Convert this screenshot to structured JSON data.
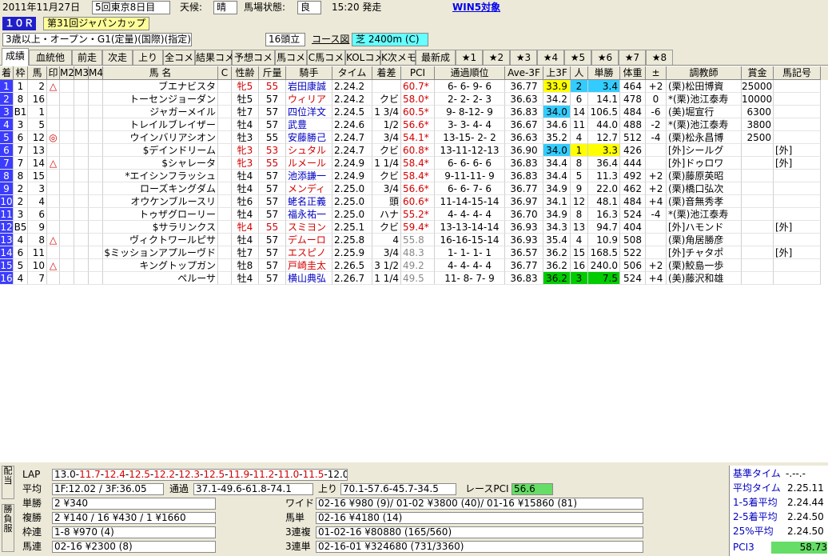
{
  "header": {
    "date": "2011年11月27日",
    "meeting": "5回東京8日目",
    "weather_label": "天候:",
    "weather": "晴",
    "track_label": "馬場状態:",
    "track": "良",
    "post_time": "15:20 発走",
    "win5": "WIN5対象",
    "race_no": "１０Ｒ",
    "race_name": "第31回ジャパンカップ",
    "condition": "3歳以上・オープン・G1(定量)(国際)(指定)",
    "runners": "16頭立",
    "course_btn": "コース図",
    "course": "芝 2400m (C)"
  },
  "tabs": [
    "成績",
    "血統他",
    "前走",
    "次走",
    "上り",
    "全コメ",
    "結果コメ",
    "予想コメ",
    "馬コメ",
    "C馬コメ",
    "KOLコメ",
    "K次メモ",
    "最新成",
    "★1",
    "★2",
    "★3",
    "★4",
    "★5",
    "★6",
    "★7",
    "★8"
  ],
  "columns": [
    "着",
    "枠",
    "馬",
    "印",
    "M2",
    "M3",
    "M4",
    "馬 名",
    "C",
    "性齢",
    "斤量",
    "騎手",
    "タイム",
    "着差",
    "PCI",
    "通過順位",
    "Ave-3F",
    "上3F",
    "人",
    "単勝",
    "体重",
    "±",
    "調教師",
    "賞金",
    "馬記号"
  ],
  "rows": [
    [
      "1",
      "1",
      "2",
      "△",
      "",
      "",
      "",
      "ブエナビスタ",
      "",
      "牝5",
      "55",
      "岩田康誠",
      "2.24.2",
      "",
      "60.7*",
      "6- 6- 9- 6",
      "36.77",
      "33.9",
      "2",
      "3.4",
      "464",
      "+2",
      "(栗)松田博資",
      "25000",
      ""
    ],
    [
      "2",
      "8",
      "16",
      "",
      "",
      "",
      "",
      "トーセンジョーダン",
      "",
      "牡5",
      "57",
      "ウィリア",
      "2.24.2",
      "クビ",
      "58.0*",
      "2- 2- 2- 3",
      "36.63",
      "34.2",
      "6",
      "14.1",
      "478",
      "0",
      "*(栗)池江泰寿",
      "10000",
      ""
    ],
    [
      "3",
      "B1",
      "1",
      "",
      "",
      "",
      "",
      "ジャガーメイル",
      "",
      "牡7",
      "57",
      "四位洋文",
      "2.24.5",
      "1 3/4",
      "60.5*",
      "9- 8-12- 9",
      "36.83",
      "34.0",
      "14",
      "106.5",
      "484",
      "-6",
      "(美)堀宣行",
      "6300",
      ""
    ],
    [
      "4",
      "3",
      "5",
      "",
      "",
      "",
      "",
      "トレイルブレイザー",
      "",
      "牡4",
      "57",
      "武豊",
      "2.24.6",
      "1/2",
      "56.6*",
      "3- 3- 4- 4",
      "36.67",
      "34.6",
      "11",
      "44.0",
      "488",
      "-2",
      "*(栗)池江泰寿",
      "3800",
      ""
    ],
    [
      "5",
      "6",
      "12",
      "◎",
      "",
      "",
      "",
      "ウインバリアシオン",
      "",
      "牡3",
      "55",
      "安藤勝己",
      "2.24.7",
      "3/4",
      "54.1*",
      "13-15- 2- 2",
      "36.63",
      "35.2",
      "4",
      "12.7",
      "512",
      "-4",
      "(栗)松永昌博",
      "2500",
      ""
    ],
    [
      "6",
      "7",
      "13",
      "",
      "",
      "",
      "",
      "$デインドリーム",
      "",
      "牝3",
      "53",
      "シュタル",
      "2.24.7",
      "クビ",
      "60.8*",
      "13-11-12-13",
      "36.90",
      "34.0",
      "1",
      "3.3",
      "426",
      "",
      "[外]シールグ",
      "",
      "[外]"
    ],
    [
      "7",
      "7",
      "14",
      "△",
      "",
      "",
      "",
      "$シャレータ",
      "",
      "牝3",
      "55",
      "ルメール",
      "2.24.9",
      "1 1/4",
      "58.4*",
      "6- 6- 6- 6",
      "36.83",
      "34.4",
      "8",
      "36.4",
      "444",
      "",
      "[外]ドゥロワ",
      "",
      "[外]"
    ],
    [
      "8",
      "8",
      "15",
      "",
      "",
      "",
      "",
      "*エイシンフラッシュ",
      "",
      "牡4",
      "57",
      "池添謙一",
      "2.24.9",
      "クビ",
      "58.4*",
      "9-11-11- 9",
      "36.83",
      "34.4",
      "5",
      "11.3",
      "492",
      "+2",
      "(栗)藤原英昭",
      "",
      ""
    ],
    [
      "9",
      "2",
      "3",
      "",
      "",
      "",
      "",
      "ローズキングダム",
      "",
      "牡4",
      "57",
      "メンディ",
      "2.25.0",
      "3/4",
      "56.6*",
      "6- 6- 7- 6",
      "36.77",
      "34.9",
      "9",
      "22.0",
      "462",
      "+2",
      "(栗)橋口弘次",
      "",
      ""
    ],
    [
      "10",
      "2",
      "4",
      "",
      "",
      "",
      "",
      "オウケンブルースリ",
      "",
      "牡6",
      "57",
      "蛯名正義",
      "2.25.0",
      "頭",
      "60.6*",
      "11-14-15-14",
      "36.97",
      "34.1",
      "12",
      "48.1",
      "484",
      "+4",
      "(栗)音無秀孝",
      "",
      ""
    ],
    [
      "11",
      "3",
      "6",
      "",
      "",
      "",
      "",
      "トゥザグローリー",
      "",
      "牡4",
      "57",
      "福永祐一",
      "2.25.0",
      "ハナ",
      "55.2*",
      "4- 4- 4- 4",
      "36.70",
      "34.9",
      "8",
      "16.3",
      "524",
      "-4",
      "*(栗)池江泰寿",
      "",
      ""
    ],
    [
      "12",
      "B5",
      "9",
      "",
      "",
      "",
      "",
      "$サラリンクス",
      "",
      "牝4",
      "55",
      "スミヨン",
      "2.25.1",
      "クビ",
      "59.4*",
      "13-13-14-14",
      "36.93",
      "34.3",
      "13",
      "94.7",
      "404",
      "",
      "[外]ハモンド",
      "",
      "[外]"
    ],
    [
      "13",
      "4",
      "8",
      "△",
      "",
      "",
      "",
      "ヴィクトワールピサ",
      "",
      "牡4",
      "57",
      "デムーロ",
      "2.25.8",
      "4",
      "55.8",
      "16-16-15-14",
      "36.93",
      "35.4",
      "4",
      "10.9",
      "508",
      "",
      "(栗)角居勝彦",
      "",
      ""
    ],
    [
      "14",
      "6",
      "11",
      "",
      "",
      "",
      "",
      "$ミッションアプルーヴド",
      "",
      "牡7",
      "57",
      "エスピノ",
      "2.25.9",
      "3/4",
      "48.3",
      "1- 1- 1- 1",
      "36.57",
      "36.2",
      "15",
      "168.5",
      "522",
      "",
      "[外]チャタポ",
      "",
      "[外]"
    ],
    [
      "15",
      "5",
      "10",
      "△",
      "",
      "",
      "",
      "キングトップガン",
      "",
      "牡8",
      "57",
      "戸崎圭太",
      "2.26.5",
      "3 1/2",
      "49.2",
      "4- 4- 4- 4",
      "36.77",
      "36.2",
      "16",
      "240.0",
      "506",
      "+2",
      "(栗)鮫島一歩",
      "",
      ""
    ],
    [
      "16",
      "4",
      "7",
      "",
      "",
      "",
      "",
      "ペルーサ",
      "",
      "牡4",
      "57",
      "横山典弘",
      "2.26.7",
      "1 1/4",
      "49.5",
      "11- 8- 7- 9",
      "36.83",
      "36.2",
      "3",
      "7.5",
      "524",
      "+4",
      "(美)藤沢和雄",
      "",
      ""
    ]
  ],
  "bottom": {
    "lap_label": "LAP",
    "lap_values": [
      "13.0",
      "11.7",
      "12.4",
      "12.5",
      "12.2",
      "12.3",
      "12.5",
      "11.9",
      "11.2",
      "11.0",
      "11.5",
      "12.0"
    ],
    "avg_label": "平均",
    "avg": "1F:12.02 / 3F:36.05",
    "pass_label": "通過",
    "pass": "37.1-49.6-61.8-74.1",
    "agari_label": "上り",
    "agari": "70.1-57.6-45.7-34.5",
    "race_pci_label": "レースPCI",
    "race_pci": "56.6",
    "vtab1": "配当",
    "vtab2": "勝負服",
    "tansho_label": "単勝",
    "tansho": "2 ¥340",
    "fukusho_label": "複勝",
    "fukusho": "2 ¥140 / 16 ¥430 / 1 ¥1660",
    "wakuren_label": "枠連",
    "wakuren": "1-8 ¥970 (4)",
    "umaren_label": "馬連",
    "umaren": "02-16 ¥2300 (8)",
    "wide_label": "ワイド",
    "wide": "02-16 ¥980 (9)/ 01-02 ¥3800 (40)/ 01-16 ¥15860 (81)",
    "umatan_label": "馬単",
    "umatan": "02-16 ¥4180 (14)",
    "sanrenpuku_label": "3連複",
    "sanrenpuku": "01-02-16 ¥80880 (165/560)",
    "sanrentan_label": "3連単",
    "sanrentan": "02-16-01 ¥324680 (731/3360)",
    "base_time_label": "基準タイム",
    "base_time": "-.--.-",
    "avg_time_label": "平均タイム",
    "avg_time": "2.25.11",
    "top5_label": "1-5着平均",
    "top5": "2.24.44",
    "top2_5_label": "2-5着平均",
    "top2_5": "2.24.50",
    "pct25_label": "25%平均",
    "pct25": "2.24.50",
    "pci3_label": "PCI3",
    "pci3": "58.73"
  },
  "colors": {
    "waku": [
      "#ffffff",
      "#000000",
      "#ff0000",
      "#0000ff",
      "#ffff00",
      "#00a000",
      "#ff8000",
      "#ff69b4"
    ],
    "rank_bg": "#3c3cff",
    "hl_yellow": "#ffff00",
    "hl_cyan": "#33ccff",
    "hl_green": "#00cc00"
  }
}
